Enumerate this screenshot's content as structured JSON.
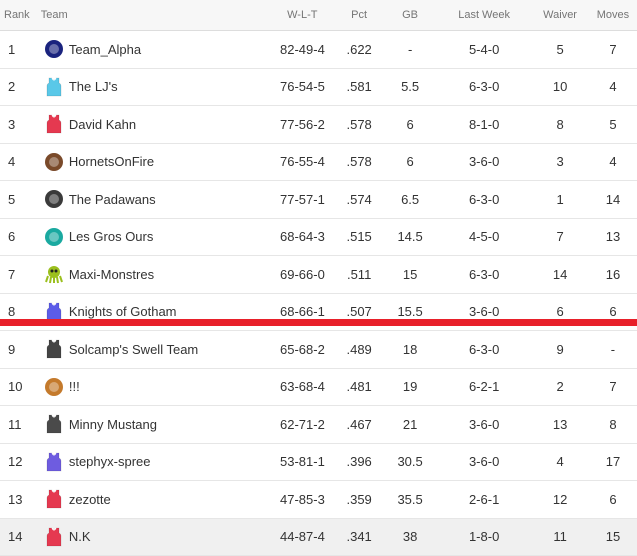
{
  "headers": {
    "rank": "Rank",
    "team": "Team",
    "wlt": "W-L-T",
    "pct": "Pct",
    "gb": "GB",
    "last_week": "Last Week",
    "waiver": "Waiver",
    "moves": "Moves"
  },
  "rows": [
    {
      "rank": "1",
      "team": "Team_Alpha",
      "wlt": "82-49-4",
      "pct": ".622",
      "gb": "-",
      "last_week": "5-4-0",
      "waiver": "5",
      "moves": "7",
      "icon": "team-logo-icon",
      "color": "#1a237e"
    },
    {
      "rank": "2",
      "team": "The LJ's",
      "wlt": "76-54-5",
      "pct": ".581",
      "gb": "5.5",
      "last_week": "6-3-0",
      "waiver": "10",
      "moves": "4",
      "icon": "jersey-icon",
      "color": "#5ac8e8"
    },
    {
      "rank": "3",
      "team": "David Kahn",
      "wlt": "77-56-2",
      "pct": ".578",
      "gb": "6",
      "last_week": "8-1-0",
      "waiver": "8",
      "moves": "5",
      "icon": "jersey-icon",
      "color": "#e53950"
    },
    {
      "rank": "4",
      "team": "HornetsOnFire",
      "wlt": "76-55-4",
      "pct": ".578",
      "gb": "6",
      "last_week": "3-6-0",
      "waiver": "3",
      "moves": "4",
      "icon": "team-logo-icon",
      "color": "#7a4a2a"
    },
    {
      "rank": "5",
      "team": "The Padawans",
      "wlt": "77-57-1",
      "pct": ".574",
      "gb": "6.5",
      "last_week": "6-3-0",
      "waiver": "1",
      "moves": "14",
      "icon": "team-logo-icon",
      "color": "#3a3a3a"
    },
    {
      "rank": "6",
      "team": "Les Gros Ours",
      "wlt": "68-64-3",
      "pct": ".515",
      "gb": "14.5",
      "last_week": "4-5-0",
      "waiver": "7",
      "moves": "13",
      "icon": "team-logo-icon",
      "color": "#1aa9a0"
    },
    {
      "rank": "7",
      "team": "Maxi-Monstres",
      "wlt": "69-66-0",
      "pct": ".511",
      "gb": "15",
      "last_week": "6-3-0",
      "waiver": "14",
      "moves": "16",
      "icon": "monster-icon",
      "color": "#9bbf1e"
    },
    {
      "rank": "8",
      "team": "Knights of Gotham",
      "wlt": "68-66-1",
      "pct": ".507",
      "gb": "15.5",
      "last_week": "3-6-0",
      "waiver": "6",
      "moves": "6",
      "icon": "jersey-icon",
      "color": "#5c5ce8"
    },
    {
      "rank": "9",
      "team": "Solcamp's Swell Team",
      "wlt": "65-68-2",
      "pct": ".489",
      "gb": "18",
      "last_week": "6-3-0",
      "waiver": "9",
      "moves": "-",
      "icon": "jersey-icon",
      "color": "#444444"
    },
    {
      "rank": "10",
      "team": "!!!",
      "wlt": "63-68-4",
      "pct": ".481",
      "gb": "19",
      "last_week": "6-2-1",
      "waiver": "2",
      "moves": "7",
      "icon": "team-logo-icon",
      "color": "#c47a2c"
    },
    {
      "rank": "11",
      "team": "Minny Mustang",
      "wlt": "62-71-2",
      "pct": ".467",
      "gb": "21",
      "last_week": "3-6-0",
      "waiver": "13",
      "moves": "8",
      "icon": "jersey-icon",
      "color": "#4a4a4a"
    },
    {
      "rank": "12",
      "team": "stephyx-spree",
      "wlt": "53-81-1",
      "pct": ".396",
      "gb": "30.5",
      "last_week": "3-6-0",
      "waiver": "4",
      "moves": "17",
      "icon": "jersey-icon",
      "color": "#6e5ce0"
    },
    {
      "rank": "13",
      "team": "zezotte",
      "wlt": "47-85-3",
      "pct": ".359",
      "gb": "35.5",
      "last_week": "2-6-1",
      "waiver": "12",
      "moves": "6",
      "icon": "jersey-icon",
      "color": "#e53950"
    },
    {
      "rank": "14",
      "team": "N.K",
      "wlt": "44-87-4",
      "pct": ".341",
      "gb": "38",
      "last_week": "1-8-0",
      "waiver": "11",
      "moves": "15",
      "icon": "jersey-icon",
      "color": "#e53950"
    }
  ],
  "colors": {
    "cutline": "#e8202a",
    "header_text": "#757575",
    "row_text": "#333333"
  }
}
